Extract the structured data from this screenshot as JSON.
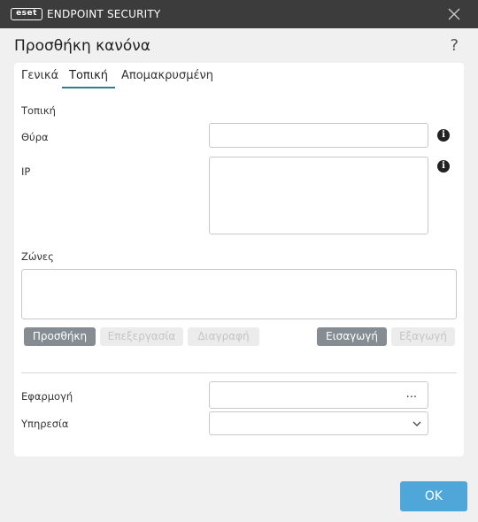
{
  "window": {
    "logo_text": "eset",
    "brand": "ENDPOINT SECURITY",
    "close_icon": "close-icon"
  },
  "dialog": {
    "title": "Προσθήκη κανόνα",
    "help": "?"
  },
  "tabs": [
    {
      "label": "Γενικά",
      "active": false
    },
    {
      "label": "Τοπική",
      "active": true
    },
    {
      "label": "Απομακρυσμένη",
      "active": false
    }
  ],
  "local": {
    "section_title": "Τοπική",
    "port_label": "Θύρα",
    "port_value": "",
    "ip_label": "IP",
    "ip_value": "",
    "info_icon": "i",
    "zones_label": "Ζώνες"
  },
  "zone_buttons": {
    "add": "Προσθήκη",
    "edit": "Επεξεργασία",
    "delete": "Διαγραφή",
    "import": "Εισαγωγή",
    "export": "Εξαγωγή"
  },
  "app": {
    "application_label": "Εφαρμογή",
    "application_value": "",
    "browse": "...",
    "service_label": "Υπηρεσία",
    "service_value": ""
  },
  "footer": {
    "ok": "OK"
  },
  "colors": {
    "titlebar": "#3c3c3c",
    "accent_tab": "#2f7f86",
    "ok_button": "#4ea7d8",
    "button_enabled": "#858d93"
  }
}
